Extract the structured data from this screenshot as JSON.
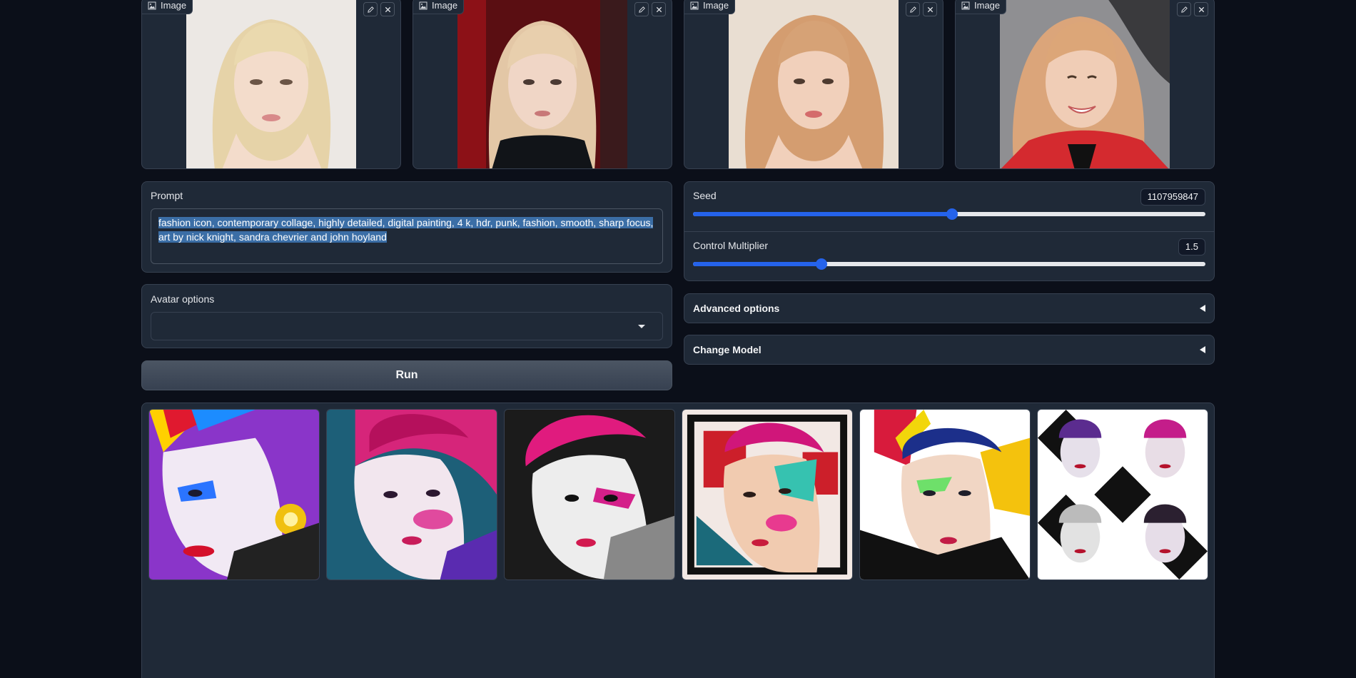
{
  "image_inputs": [
    {
      "label": "Image",
      "edit_icon": "pencil-icon",
      "clear_icon": "close-icon"
    },
    {
      "label": "Image",
      "edit_icon": "pencil-icon",
      "clear_icon": "close-icon"
    },
    {
      "label": "Image",
      "edit_icon": "pencil-icon",
      "clear_icon": "close-icon"
    },
    {
      "label": "Image",
      "edit_icon": "pencil-icon",
      "clear_icon": "close-icon"
    }
  ],
  "prompt": {
    "label": "Prompt",
    "value": "fashion icon, contemporary collage, highly detailed, digital painting, 4 k, hdr, punk, fashion, smooth, sharp focus, art by nick knight, sandra chevrier and john hoyland"
  },
  "avatar_options": {
    "label": "Avatar options",
    "selected": ""
  },
  "run_button": {
    "label": "Run"
  },
  "seed": {
    "label": "Seed",
    "value": "1107959847",
    "fraction": 0.505
  },
  "control_multiplier": {
    "label": "Control Multiplier",
    "value": "1.5",
    "fraction": 0.25
  },
  "advanced_options": {
    "label": "Advanced options"
  },
  "change_model": {
    "label": "Change Model"
  },
  "gallery": {
    "count": 6
  },
  "colors": {
    "background": "#0b0f19",
    "panel": "#1f2937",
    "accent": "#2563eb",
    "selection": "#3b6ea6"
  }
}
